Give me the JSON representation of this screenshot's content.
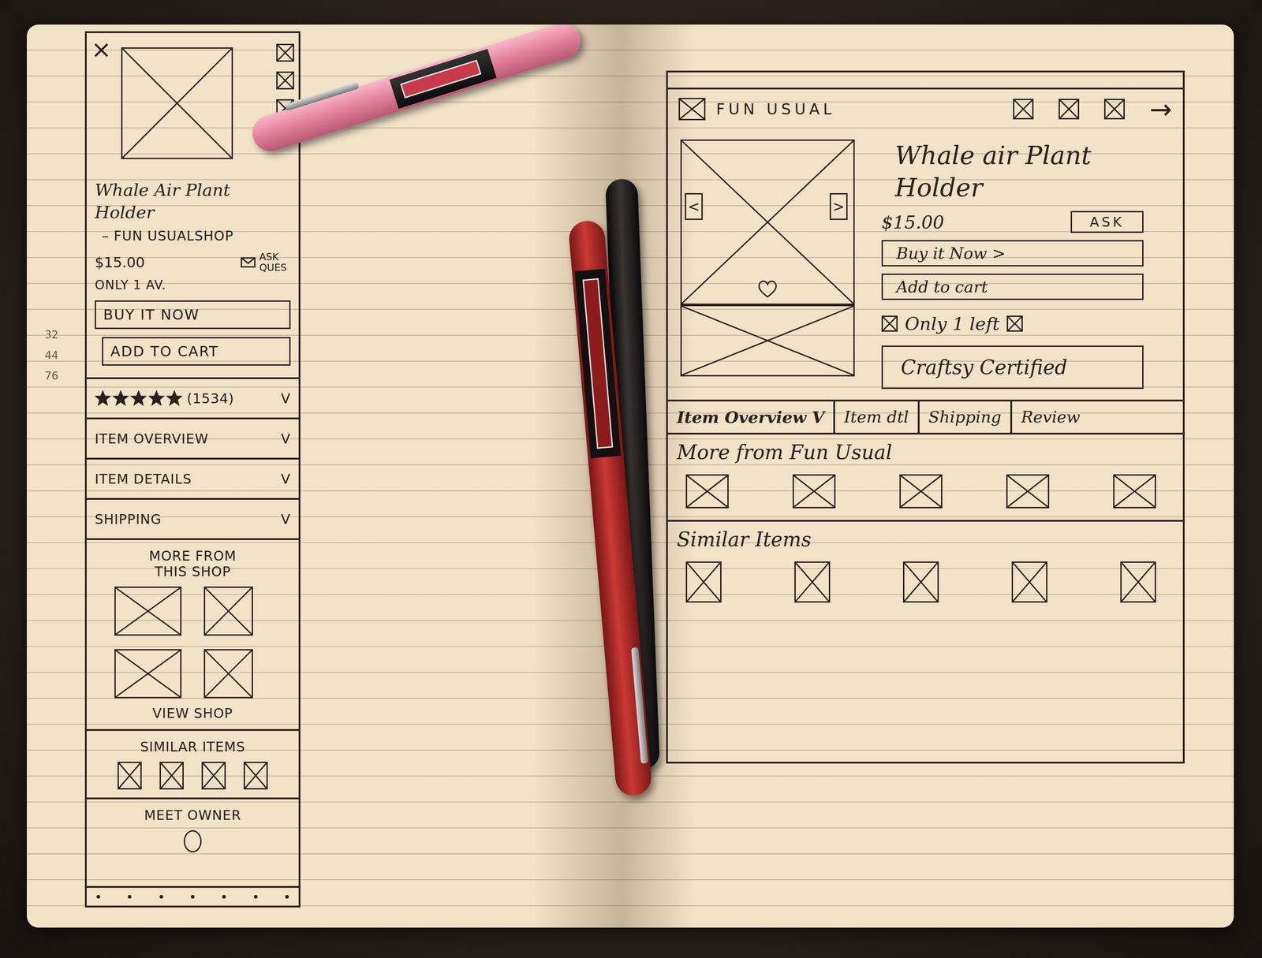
{
  "margin_notes": [
    "32",
    "44",
    "76"
  ],
  "mobile": {
    "close": "×",
    "title": "Whale Air Plant Holder",
    "shop": "– FUN USUALSHOP",
    "price": "$15.00",
    "ask": "ASK QUES",
    "availability": "ONLY 1 AV.",
    "buy_button": "BUY IT NOW",
    "cart_button": "ADD TO CART",
    "rating": {
      "stars": 5,
      "count": "(1534)",
      "chevron": "V"
    },
    "accordions": [
      {
        "label": "ITEM OVERVIEW",
        "chevron": "V"
      },
      {
        "label": "ITEM DETAILS",
        "chevron": "V"
      },
      {
        "label": "SHIPPING",
        "chevron": "V"
      }
    ],
    "more_from_shop": {
      "title": "MORE FROM THIS SHOP",
      "link": "VIEW SHOP"
    },
    "similar_title": "SIMILAR ITEMS",
    "meet_owner": "MEET OWNER"
  },
  "desktop": {
    "shop_name": "FUN USUAL",
    "arrow": "→",
    "prev": "<",
    "next": ">",
    "title": "Whale air Plant Holder",
    "price": "$15.00",
    "ask": "ASK",
    "buy_button": "Buy it Now >",
    "cart_button": "Add to cart",
    "stock": "Only 1 left",
    "badge": "Craftsy Certified",
    "tabs": [
      {
        "label": "Item Overview V",
        "selected": true
      },
      {
        "label": "Item dtl",
        "selected": false
      },
      {
        "label": "Shipping",
        "selected": false
      },
      {
        "label": "Review",
        "selected": false
      }
    ],
    "more_title": "More from Fun Usual",
    "similar_title": "Similar Items"
  }
}
